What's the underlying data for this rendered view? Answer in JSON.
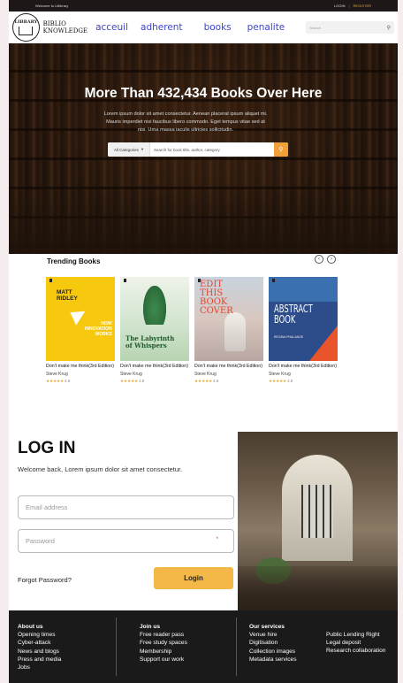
{
  "topbar": {
    "welcome": "Welcome to Ltilibrary",
    "login": "LOGIN",
    "separator": "|",
    "register": "REGISTER"
  },
  "header": {
    "logo_text": "LIBRARY",
    "brand_line1": "BIBLIO",
    "brand_line2": "KNOWLEDGE",
    "nav": [
      "acceuil",
      "adherent",
      "books",
      "penalite"
    ],
    "search_placeholder": "Search"
  },
  "hero": {
    "title": "More Than 432,434 Books Over Here",
    "description": "Lorem ipsum dolor sit amet consectetur. Aenean placerat ipsum aliquet mi. Mauris imperdiet nisi faucibus libero commodo. Eget tempus vitae sed at nisi. Urna massa iaculis ultricies sollicitudin.",
    "category_select": "All Categories",
    "search_placeholder": "Search for book title, author, category"
  },
  "trending": {
    "title": "Trending Books",
    "books": [
      {
        "cover_line1": "MATT",
        "cover_line2": "RIDLEY",
        "cover_sub1": "HOW",
        "cover_sub2": "INNOVATION",
        "cover_sub3": "WORKS",
        "title": "Don't make me think(3rd Edition)",
        "author": "Steve Krug",
        "stars": "★★★★★",
        "rating": "4.8"
      },
      {
        "cover_line1": "The Labyrinth",
        "cover_line2": "of Whispers",
        "title": "Don't make me think(3rd Edition)",
        "author": "Steve Krug",
        "stars": "★★★★★",
        "rating": "4.8"
      },
      {
        "cover_line1": "EDIT",
        "cover_line2": "THIS",
        "cover_line3": "BOOK",
        "cover_line4": "COVER",
        "title": "Don't make me think(3rd Edition)",
        "author": "Steve Krug",
        "stars": "★★★★★",
        "rating": "4.8"
      },
      {
        "cover_line1": "ABSTRACT",
        "cover_line2": "BOOK",
        "cover_sub1": "REGINA PHALANGE",
        "title": "Don't make me think(3rd Edition)",
        "author": "Steve Krug",
        "stars": "★★★★★",
        "rating": "4.8"
      }
    ]
  },
  "login": {
    "title": "LOG IN",
    "subtitle": "Welcome back, Lorem ipsum dolor sit amet consectetur.",
    "email_placeholder": "Email address",
    "password_placeholder": "Password",
    "required_mark": "*",
    "forgot": "Forgot Password?",
    "button": "Login"
  },
  "footer": {
    "about": {
      "heading": "About us",
      "items": [
        "Opening times",
        "Cyber-attack",
        "News and blogs",
        "Press and media",
        "Jobs"
      ]
    },
    "join": {
      "heading": "Join us",
      "items": [
        "Free reader pass",
        "Free study spaces",
        "Membership",
        "Support our work"
      ]
    },
    "services": {
      "heading": "Our services",
      "items": [
        "Venue hire",
        "Digitisation",
        "Collection images",
        "Metadata services"
      ]
    },
    "services2": {
      "items": [
        "Public Lending Right",
        "Legal deposit",
        "Research collaboration"
      ]
    }
  },
  "colors": {
    "nav": "#3d45c9",
    "accent": "#f4b849",
    "footer_bg": "#1a1a1a",
    "topbar_bg": "#1d1718"
  }
}
